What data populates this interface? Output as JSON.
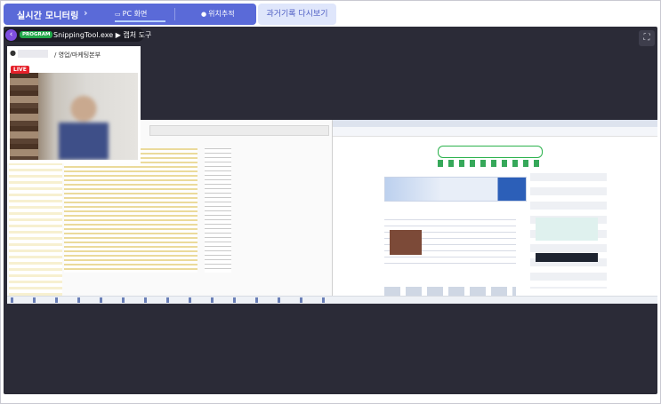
{
  "nav": {
    "realtime_monitoring": "실시간 모니터링",
    "chevron": "›",
    "pc_screen": "PC 화면",
    "location_tracking": "위치추적",
    "history_replay": "과거기록 다시보기"
  },
  "viewer": {
    "program_badge": "PROGRAM",
    "program_name": "SnippingTool.exe ▶ 캡처 도구",
    "back_arrow": "‹",
    "expand_glyph": "⛶"
  },
  "user": {
    "department": "/ 영업/마케팅본부",
    "live_badge": "LIVE"
  },
  "icons": {
    "monitor": "monitor-icon",
    "person": "person-icon",
    "back": "chevron-left-icon",
    "expand": "expand-icon"
  },
  "colors": {
    "nav_bg": "#5a6ad8",
    "history_bg": "#dfe6fb",
    "viewer_bg": "#2b2b37",
    "program_badge": "#22a84a",
    "live_badge": "#e5212a",
    "back_button": "#7e4ee0"
  }
}
